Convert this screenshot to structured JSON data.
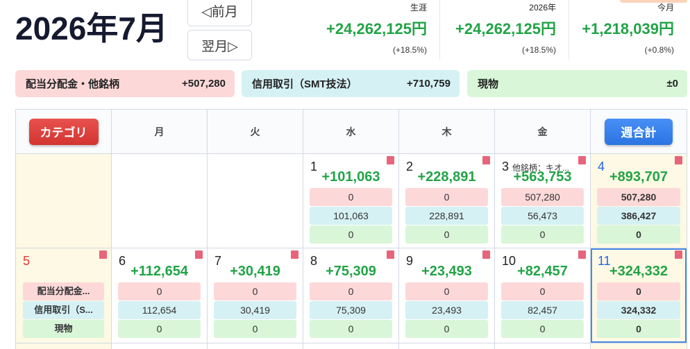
{
  "header": {
    "title": "2026年7月",
    "prev_month": "◁前月",
    "next_month": "翌月▷"
  },
  "stats": [
    {
      "label": "生涯",
      "value": "+24,262,125円",
      "pct": "(+18.5%)"
    },
    {
      "label": "2026年",
      "value": "+24,262,125円",
      "pct": "(+18.5%)"
    },
    {
      "label": "今月",
      "value": "+1,218,039円",
      "pct": "(+0.8%)"
    }
  ],
  "category_totals": [
    {
      "label": "配当分配金・他銘柄",
      "value": "+507,280"
    },
    {
      "label": "信用取引（SMT技法）",
      "value": "+710,759"
    },
    {
      "label": "現物",
      "value": "±0"
    }
  ],
  "calendar": {
    "category_button": "カテゴリ",
    "weekdays": [
      "月",
      "火",
      "水",
      "木",
      "金"
    ],
    "week_total_button": "週合計",
    "weeks": [
      {
        "sunday": {},
        "days": [
          {},
          {},
          {
            "day": "1",
            "total": "+101,063",
            "dividend": "0",
            "margin": "101,063",
            "cash": "0",
            "flag": true
          },
          {
            "day": "2",
            "total": "+228,891",
            "dividend": "0",
            "margin": "228,891",
            "cash": "0",
            "flag": true
          },
          {
            "day": "3",
            "note": "他銘柄：キオ...",
            "total": "+563,753",
            "dividend": "507,280",
            "margin": "56,473",
            "cash": "0",
            "flag": true
          }
        ],
        "week_total": {
          "day": "4",
          "total": "+893,707",
          "dividend": "507,280",
          "margin": "386,427",
          "cash": "0",
          "flag": true
        }
      },
      {
        "sunday": {
          "day": "5",
          "flag": true,
          "labels": [
            "配当分配金...",
            "信用取引（S...",
            "現物"
          ]
        },
        "days": [
          {
            "day": "6",
            "total": "+112,654",
            "dividend": "0",
            "margin": "112,654",
            "cash": "0",
            "flag": true
          },
          {
            "day": "7",
            "total": "+30,419",
            "dividend": "0",
            "margin": "30,419",
            "cash": "0",
            "flag": true
          },
          {
            "day": "8",
            "total": "+75,309",
            "dividend": "0",
            "margin": "75,309",
            "cash": "0",
            "flag": true
          },
          {
            "day": "9",
            "total": "+23,493",
            "dividend": "0",
            "margin": "23,493",
            "cash": "0",
            "flag": true
          },
          {
            "day": "10",
            "total": "+82,457",
            "dividend": "0",
            "margin": "82,457",
            "cash": "0",
            "flag": true
          }
        ],
        "week_total": {
          "day": "11",
          "total": "+324,332",
          "dividend": "0",
          "margin": "324,332",
          "cash": "0",
          "flag": true,
          "selected": true
        }
      }
    ]
  },
  "colors": {
    "positive": "#22a347",
    "dividend_bg": "#fdd8d9",
    "margin_bg": "#d5f1f4",
    "cash_bg": "#d9f6d9",
    "weekend_bg": "#fdf9e4",
    "category_button": "#e53935",
    "week_total_button": "#2f7ff5",
    "saturday": "#2563eb",
    "sunday": "#e53935",
    "flag": "#e8647b",
    "selected_border": "#4a86e8",
    "title": "#151a30",
    "partial_button": "#fcd3b8"
  }
}
